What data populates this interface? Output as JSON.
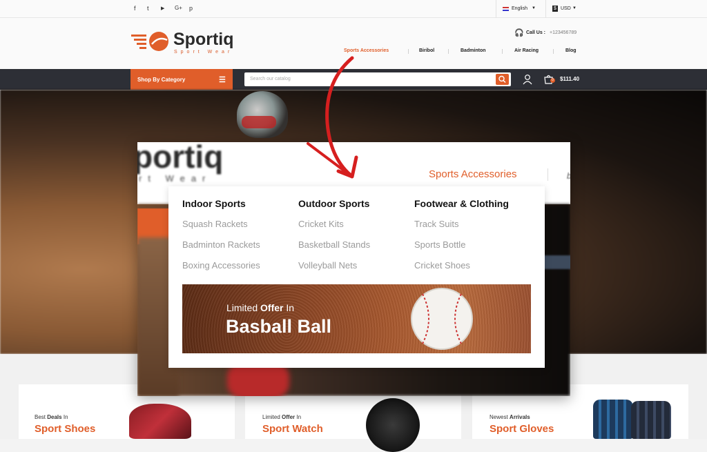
{
  "topbar": {
    "social_icons": [
      "facebook-icon",
      "twitter-icon",
      "youtube-icon",
      "google-plus-icon",
      "pinterest-icon"
    ],
    "social_glyphs": [
      "f",
      "t",
      "▶",
      "G+",
      "p"
    ],
    "language": "English",
    "currency_symbol": "$",
    "currency": "USD"
  },
  "header": {
    "brand_name": "Sportiq",
    "tagline": "Sport Wear",
    "call_label": "Call Us :",
    "phone": "+123456789",
    "nav": [
      "Sports Accessories",
      "Biribol",
      "Badminton",
      "Air Racing",
      "Blog"
    ],
    "active_nav": "Sports Accessories"
  },
  "searchbar": {
    "category_label": "Shop By Category",
    "search_placeholder": "Search our catalog",
    "cart_count": "0",
    "cart_total": "$111.40"
  },
  "zoom": {
    "brand_fragment": "portiq",
    "tagline_fragment": "rt Wear",
    "active_nav": "Sports Accessories",
    "next_nav_fragment": "bo",
    "columns": [
      {
        "heading": "Indoor Sports",
        "items": [
          "Squash Rackets",
          "Badminton Rackets",
          "Boxing Accessories"
        ]
      },
      {
        "heading": "Outdoor Sports",
        "items": [
          "Cricket Kits",
          "Basketball Stands",
          "Volleyball Nets"
        ]
      },
      {
        "heading": "Footwear & Clothing",
        "items": [
          "Track Suits",
          "Sports Bottle",
          "Cricket Shoes"
        ]
      }
    ],
    "banner": {
      "line1_prefix": "Limited",
      "line1_bold": "Offer",
      "line1_suffix": "In",
      "title": "Basball Ball"
    }
  },
  "cards": [
    {
      "small_prefix": "Best",
      "small_bold": "Deals",
      "small_suffix": "In",
      "title": "Sport Shoes"
    },
    {
      "small_prefix": "Limited",
      "small_bold": "Offer",
      "small_suffix": "In",
      "title": "Sport Watch"
    },
    {
      "small_prefix": "Newest",
      "small_bold": "Arrivals",
      "small_suffix": "",
      "title": "Sport Gloves"
    }
  ],
  "colors": {
    "accent": "#e05e2a",
    "dark_bar": "#2d2f36"
  }
}
